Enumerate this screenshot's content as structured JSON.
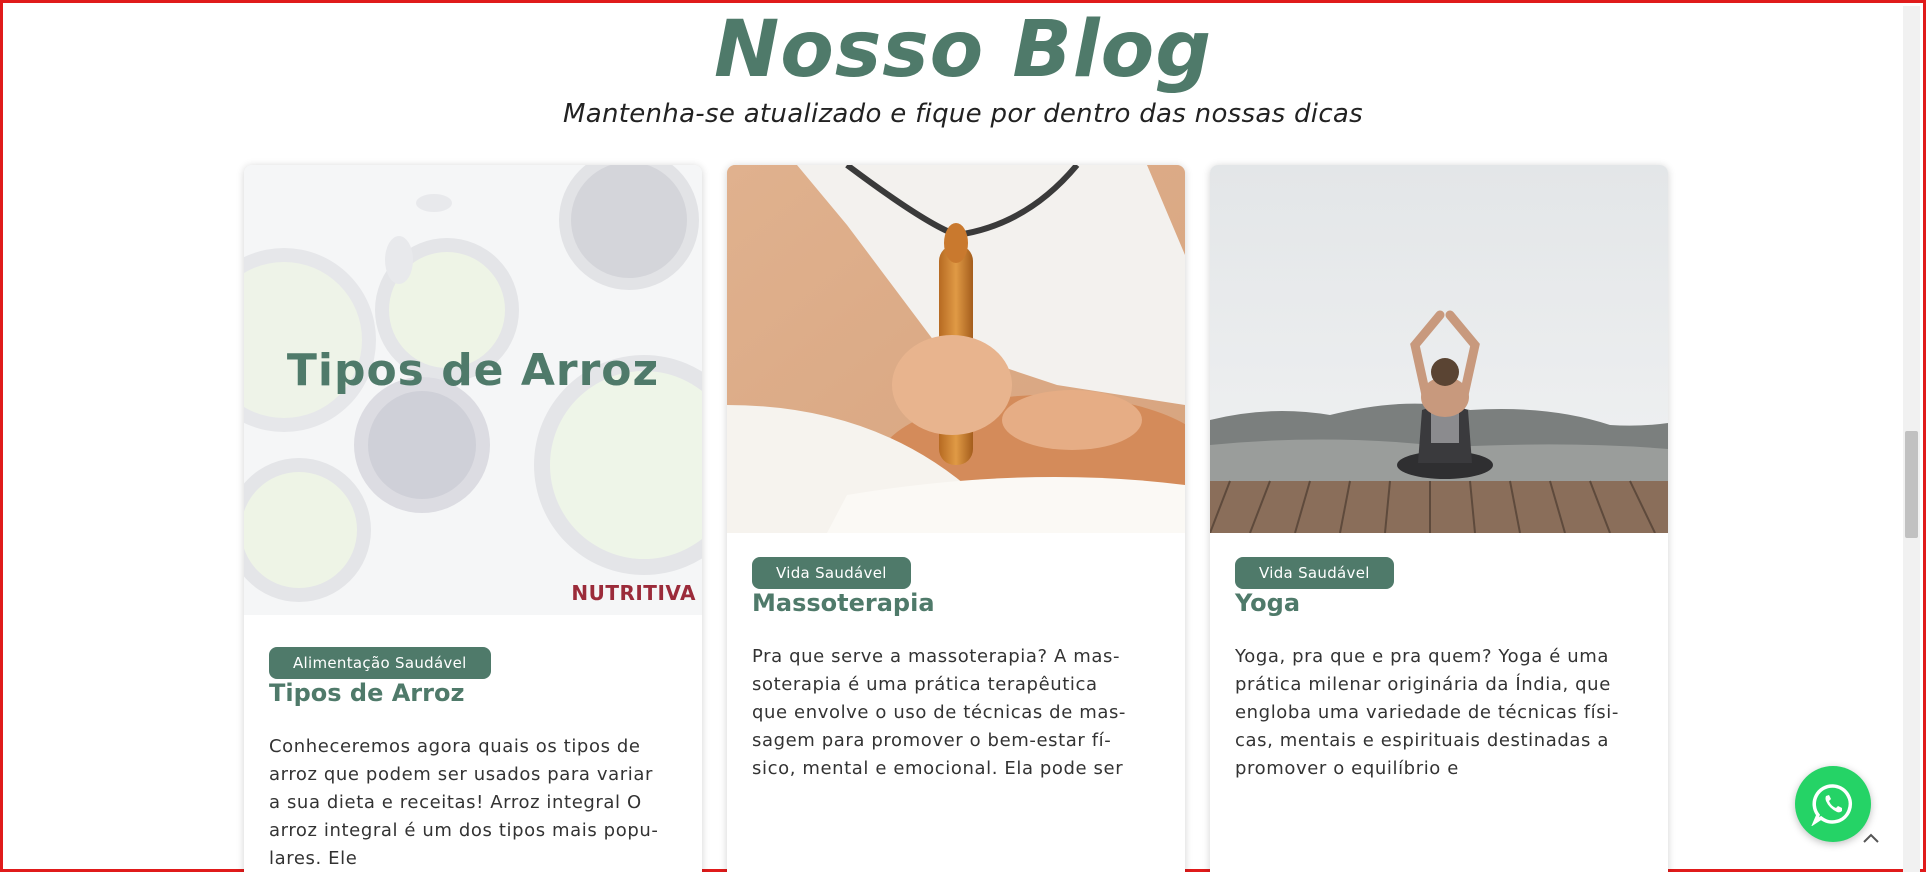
{
  "section": {
    "title": "Nosso Blog",
    "subtitle": "Mantenha-se atualizado e fique por dentro das nossas dicas"
  },
  "posts": [
    {
      "category": "Alimentação Saudável",
      "title": "Tipos de Arroz",
      "excerpt_lines": [
        "Conheceremos agora quais os tipos de",
        "arroz que podem ser usados para variar",
        "a sua dieta e receitas! Arroz integral O",
        "arroz integral é um dos tipos mais popu-",
        "lares. Ele"
      ],
      "image_heading": "Tipos de Arroz",
      "image_logo": "NUTRITIVA"
    },
    {
      "category": "Vida Saudável",
      "title": "Massoterapia",
      "excerpt_lines": [
        "Pra que serve a massoterapia? A mas-",
        "soterapia é uma prática terapêutica",
        "que envolve o uso de técnicas de mas-",
        "sagem para promover o bem-estar fí-",
        "sico, mental e emocional. Ela pode ser"
      ]
    },
    {
      "category": "Vida Saudável",
      "title": "Yoga",
      "excerpt_lines": [
        "Yoga, pra que e pra quem? Yoga é uma",
        "prática milenar originária da Índia, que",
        "engloba uma variedade de técnicas físi-",
        "cas, mentais e espirituais destinadas a",
        "promover o equilíbrio e"
      ]
    }
  ],
  "floating": {
    "whatsapp_icon": "whatsapp-icon",
    "scroll_top_icon": "chevron-up-icon"
  },
  "colors": {
    "accent": "#4f7a6a",
    "whatsapp": "#25d366",
    "frame": "#e01b1b"
  }
}
